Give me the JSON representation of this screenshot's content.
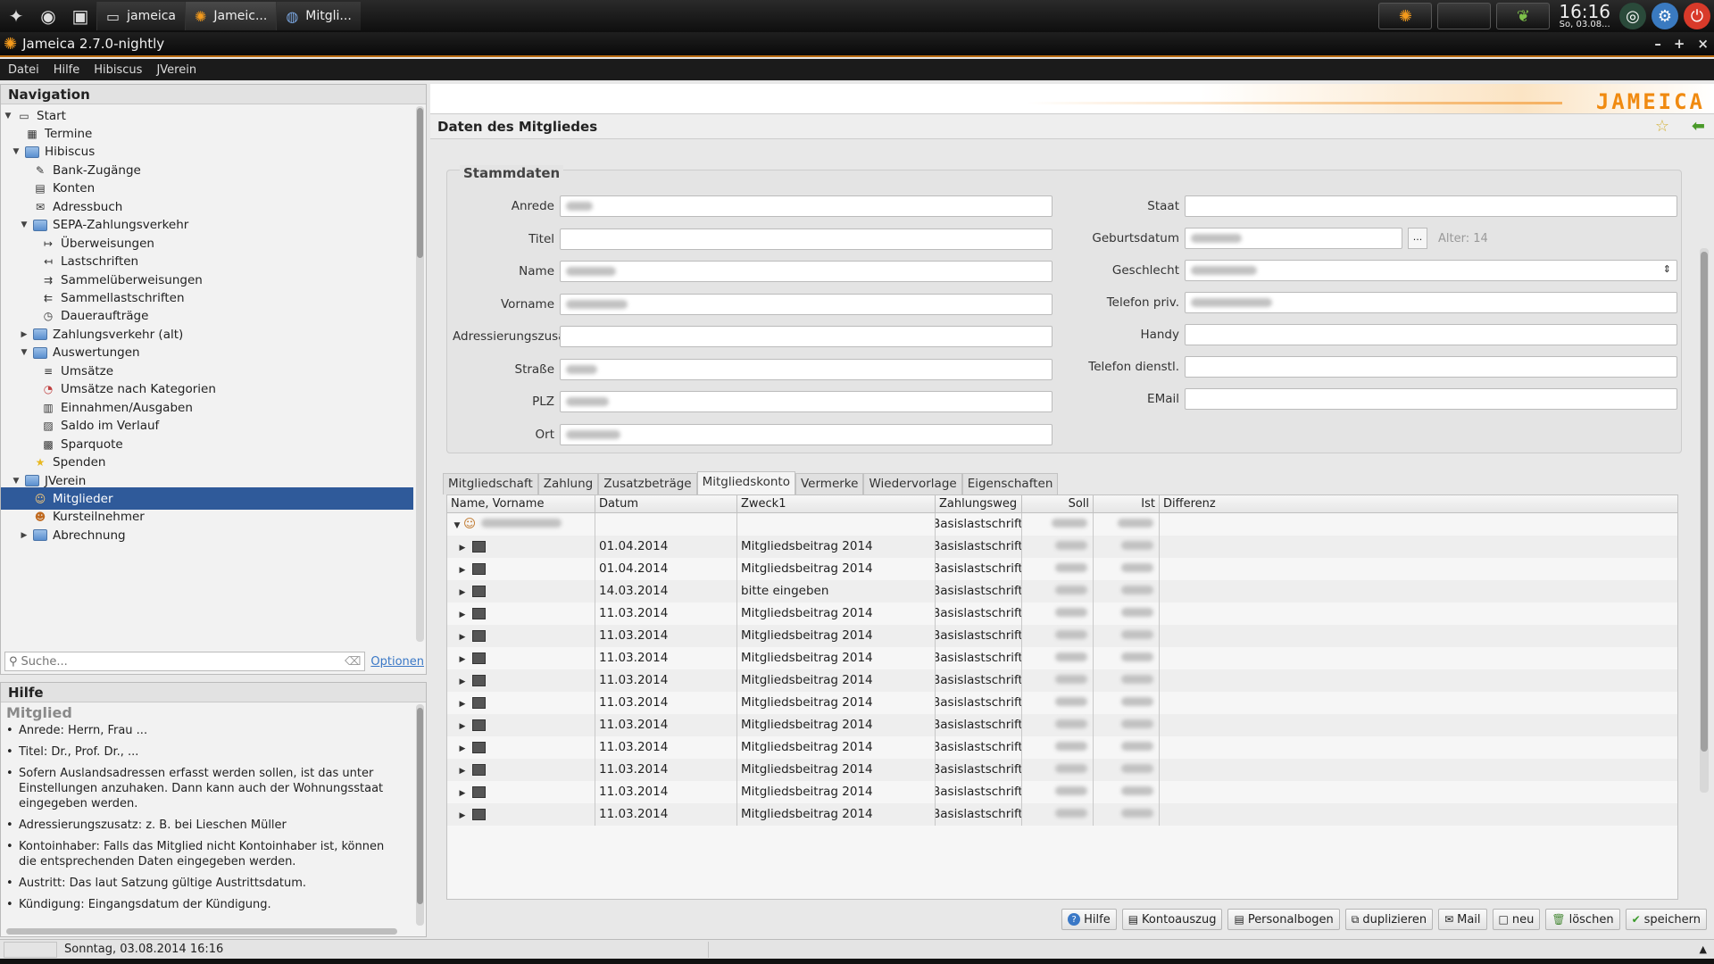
{
  "taskbar": {
    "tasks": [
      {
        "label": "jameica",
        "icon": "terminal-icon"
      },
      {
        "label": "Jameic...",
        "icon": "jameica-icon"
      },
      {
        "label": "Mitgli...",
        "icon": "globe-icon"
      }
    ],
    "clock_time": "16:16",
    "clock_date": "So, 03.08..."
  },
  "window": {
    "title": "Jameica 2.7.0-nightly"
  },
  "menu": [
    "Datei",
    "Hilfe",
    "Hibiscus",
    "JVerein"
  ],
  "navigation": {
    "title": "Navigation",
    "items": [
      {
        "label": "Start",
        "icon": "monitor-icon",
        "level": 0,
        "toggle": "▼"
      },
      {
        "label": "Termine",
        "icon": "calendar-icon",
        "level": 1,
        "toggle": ""
      },
      {
        "label": "Hibiscus",
        "icon": "folder-icon",
        "level": 1,
        "toggle": "▼"
      },
      {
        "label": "Bank-Zugänge",
        "icon": "bank-icon",
        "level": 2,
        "toggle": ""
      },
      {
        "label": "Konten",
        "icon": "account-icon",
        "level": 2,
        "toggle": ""
      },
      {
        "label": "Adressbuch",
        "icon": "addressbook-icon",
        "level": 2,
        "toggle": ""
      },
      {
        "label": "SEPA-Zahlungsverkehr",
        "icon": "folder-icon",
        "level": 2,
        "toggle": "▼"
      },
      {
        "label": "Überweisungen",
        "icon": "transfer-icon",
        "level": 3,
        "toggle": ""
      },
      {
        "label": "Lastschriften",
        "icon": "debit-icon",
        "level": 3,
        "toggle": ""
      },
      {
        "label": "Sammelüberweisungen",
        "icon": "batch-transfer-icon",
        "level": 3,
        "toggle": ""
      },
      {
        "label": "Sammellastschriften",
        "icon": "batch-debit-icon",
        "level": 3,
        "toggle": ""
      },
      {
        "label": "Daueraufträge",
        "icon": "clock-icon",
        "level": 3,
        "toggle": ""
      },
      {
        "label": "Zahlungsverkehr (alt)",
        "icon": "folder-icon",
        "level": 2,
        "toggle": "▶"
      },
      {
        "label": "Auswertungen",
        "icon": "folder-icon",
        "level": 2,
        "toggle": "▼"
      },
      {
        "label": "Umsätze",
        "icon": "transactions-icon",
        "level": 3,
        "toggle": ""
      },
      {
        "label": "Umsätze nach Kategorien",
        "icon": "pie-chart-icon",
        "level": 3,
        "toggle": ""
      },
      {
        "label": "Einnahmen/Ausgaben",
        "icon": "income-expense-icon",
        "level": 3,
        "toggle": ""
      },
      {
        "label": "Saldo im Verlauf",
        "icon": "balance-chart-icon",
        "level": 3,
        "toggle": ""
      },
      {
        "label": "Sparquote",
        "icon": "savings-chart-icon",
        "level": 3,
        "toggle": ""
      },
      {
        "label": "Spenden",
        "icon": "star-icon",
        "level": 2,
        "toggle": ""
      },
      {
        "label": "JVerein",
        "icon": "folder-icon",
        "level": 1,
        "toggle": "▼"
      },
      {
        "label": "Mitglieder",
        "icon": "members-icon",
        "level": 2,
        "toggle": "",
        "selected": true
      },
      {
        "label": "Kursteilnehmer",
        "icon": "participants-icon",
        "level": 2,
        "toggle": ""
      },
      {
        "label": "Abrechnung",
        "icon": "folder-icon",
        "level": 2,
        "toggle": "▶"
      }
    ],
    "search_placeholder": "Suche...",
    "options_label": "Optionen"
  },
  "help": {
    "title": "Hilfe",
    "topic": "Mitglied",
    "items": [
      "Anrede: Herrn, Frau ...",
      "Titel: Dr., Prof. Dr., ...",
      "Sofern Auslandsadressen erfasst werden sollen, ist das unter Einstellungen anzuhaken. Dann kann auch der Wohnungsstaat eingegeben werden.",
      "Adressierungszusatz: z. B. bei Lieschen Müller",
      "Kontoinhaber: Falls das Mitglied nicht Kontoinhaber ist, können die entsprechenden Daten eingegeben werden.",
      "Austritt: Das laut Satzung gültige Austrittsdatum.",
      "Kündigung: Eingangsdatum der Kündigung."
    ]
  },
  "main": {
    "brand": "JAMEICA",
    "view_title": "Daten des Mitgliedes",
    "stammdaten": {
      "legend": "Stammdaten",
      "left_fields": [
        {
          "label": "Anrede",
          "blurred": true
        },
        {
          "label": "Titel",
          "blurred": false
        },
        {
          "label": "Name",
          "blurred": true
        },
        {
          "label": "Vorname",
          "blurred": true
        },
        {
          "label": "Adressierungszusatz",
          "blurred": false
        },
        {
          "label": "Straße",
          "blurred": true
        },
        {
          "label": "PLZ",
          "blurred": true
        },
        {
          "label": "Ort",
          "blurred": true
        }
      ],
      "right_fields": [
        {
          "label": "Staat",
          "blurred": false
        },
        {
          "label": "Geburtsdatum",
          "blurred": true
        },
        {
          "label": "Geschlecht",
          "blurred": true
        },
        {
          "label": "Telefon priv.",
          "blurred": true
        },
        {
          "label": "Handy",
          "blurred": false
        },
        {
          "label": "Telefon dienstl.",
          "blurred": false
        },
        {
          "label": "EMail",
          "blurred": false
        }
      ],
      "age_label": "Alter: 14",
      "date_button": "..."
    },
    "tabs": [
      "Mitgliedschaft",
      "Zahlung",
      "Zusatzbeträge",
      "Mitgliedskonto",
      "Vermerke",
      "Wiedervorlage",
      "Eigenschaften"
    ],
    "active_tab": "Mitgliedskonto",
    "table": {
      "columns": [
        "Name, Vorname",
        "Datum",
        "Zweck1",
        "Zahlungsweg",
        "Soll",
        "Ist",
        "Differenz"
      ],
      "group_payment": "Basislastschrift",
      "rows": [
        {
          "datum": "01.04.2014",
          "zweck": "Mitgliedsbeitrag 2014",
          "weg": "Basislastschrift"
        },
        {
          "datum": "01.04.2014",
          "zweck": "Mitgliedsbeitrag 2014",
          "weg": "Basislastschrift"
        },
        {
          "datum": "14.03.2014",
          "zweck": "bitte eingeben",
          "weg": "Basislastschrift"
        },
        {
          "datum": "11.03.2014",
          "zweck": "Mitgliedsbeitrag 2014",
          "weg": "Basislastschrift"
        },
        {
          "datum": "11.03.2014",
          "zweck": "Mitgliedsbeitrag 2014",
          "weg": "Basislastschrift"
        },
        {
          "datum": "11.03.2014",
          "zweck": "Mitgliedsbeitrag 2014",
          "weg": "Basislastschrift"
        },
        {
          "datum": "11.03.2014",
          "zweck": "Mitgliedsbeitrag 2014",
          "weg": "Basislastschrift"
        },
        {
          "datum": "11.03.2014",
          "zweck": "Mitgliedsbeitrag 2014",
          "weg": "Basislastschrift"
        },
        {
          "datum": "11.03.2014",
          "zweck": "Mitgliedsbeitrag 2014",
          "weg": "Basislastschrift"
        },
        {
          "datum": "11.03.2014",
          "zweck": "Mitgliedsbeitrag 2014",
          "weg": "Basislastschrift"
        },
        {
          "datum": "11.03.2014",
          "zweck": "Mitgliedsbeitrag 2014",
          "weg": "Basislastschrift"
        },
        {
          "datum": "11.03.2014",
          "zweck": "Mitgliedsbeitrag 2014",
          "weg": "Basislastschrift"
        },
        {
          "datum": "11.03.2014",
          "zweck": "Mitgliedsbeitrag 2014",
          "weg": "Basislastschrift"
        }
      ]
    },
    "buttons": [
      {
        "label": "Hilfe",
        "icon": "help-icon",
        "glyph": "?"
      },
      {
        "label": "Kontoauszug",
        "icon": "statement-icon",
        "glyph": "▤"
      },
      {
        "label": "Personalbogen",
        "icon": "personal-sheet-icon",
        "glyph": "▤"
      },
      {
        "label": "duplizieren",
        "icon": "duplicate-icon",
        "glyph": "⧉"
      },
      {
        "label": "Mail",
        "icon": "mail-icon",
        "glyph": "✉"
      },
      {
        "label": "neu",
        "icon": "new-icon",
        "glyph": "□"
      },
      {
        "label": "löschen",
        "icon": "delete-icon",
        "glyph": "🗑"
      },
      {
        "label": "speichern",
        "icon": "save-icon",
        "glyph": "✔"
      }
    ]
  },
  "statusbar": {
    "text": "Sonntag, 03.08.2014 16:16"
  },
  "colors": {
    "accent": "#f39a1c",
    "selection": "#2f5a9a",
    "link": "#3a78c6"
  }
}
